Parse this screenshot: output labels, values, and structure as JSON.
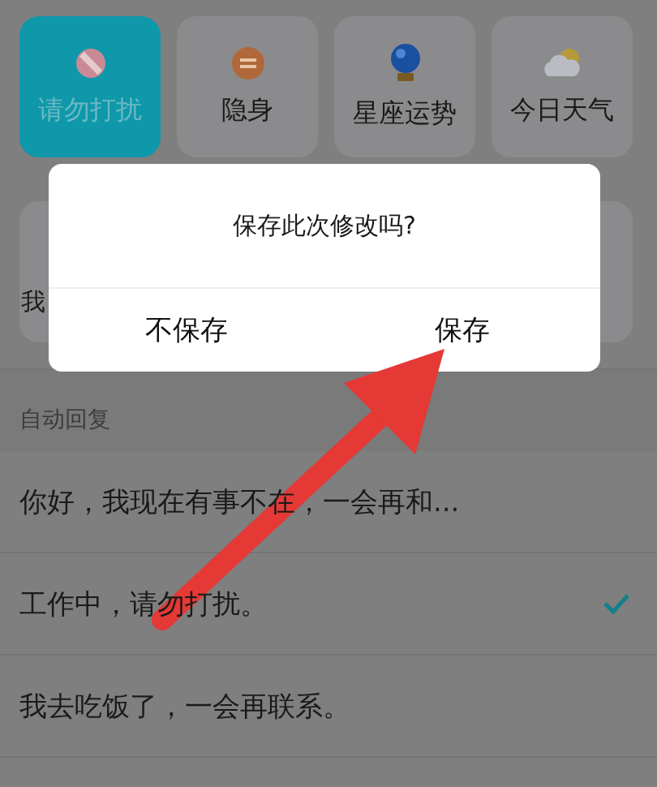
{
  "modes": [
    {
      "label": "请勿打扰",
      "selected": true
    },
    {
      "label": "隐身",
      "selected": false
    },
    {
      "label": "星座运势",
      "selected": false
    },
    {
      "label": "今日天气",
      "selected": false
    }
  ],
  "second_row": [
    {
      "label": "我"
    }
  ],
  "dialog": {
    "title": "保存此次修改吗?",
    "buttons": [
      "不保存",
      "保存"
    ]
  },
  "auto_reply": {
    "header": "自动回复",
    "items": [
      {
        "text": "你好，我现在有事不在，一会再和...",
        "selected": false
      },
      {
        "text": "工作中，请勿打扰。",
        "selected": true
      },
      {
        "text": "我去吃饭了，一会再联系。",
        "selected": false
      }
    ]
  }
}
